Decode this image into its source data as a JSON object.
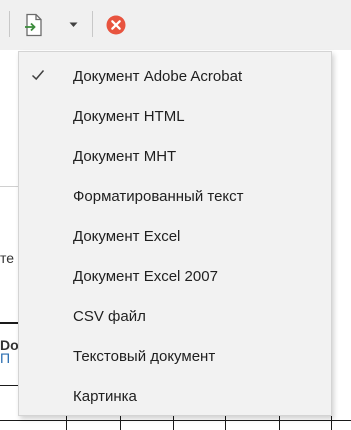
{
  "toolbar": {
    "export_icon": "export-document-icon",
    "dropdown_icon": "chevron-down-icon",
    "close_icon": "close-circle-icon",
    "close_color": "#e8543f"
  },
  "background": {
    "fragment_1": "те",
    "fragment_2": "Do",
    "fragment_3": "П"
  },
  "menu": {
    "checked_index": 0,
    "items": [
      {
        "label": "Документ Adobe Acrobat"
      },
      {
        "label": "Документ HTML"
      },
      {
        "label": "Документ MHT"
      },
      {
        "label": "Форматированный текст"
      },
      {
        "label": "Документ Excel"
      },
      {
        "label": "Документ Excel 2007"
      },
      {
        "label": "CSV файл"
      },
      {
        "label": "Текстовый документ"
      },
      {
        "label": "Картинка"
      }
    ]
  }
}
